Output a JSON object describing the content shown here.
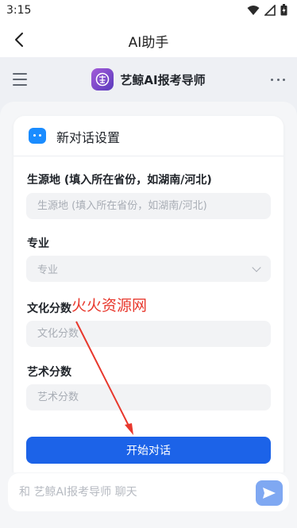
{
  "status_bar": {
    "time": "3:15"
  },
  "app_bar": {
    "title": "AI助手"
  },
  "chat_header": {
    "bot_name": "艺鲸AI报考导师"
  },
  "card": {
    "title": "新对话设置",
    "fields": [
      {
        "label": "生源地 (填入所在省份，如湖南/河北)",
        "placeholder": "生源地 (填入所在省份，如湖南/河北)"
      },
      {
        "label": "专业",
        "placeholder": "专业"
      },
      {
        "label": "文化分数",
        "placeholder": "文化分数"
      },
      {
        "label": "艺术分数",
        "placeholder": "艺术分数"
      }
    ],
    "start_button": "开始对话"
  },
  "chat_input": {
    "placeholder": "和 艺鲸AI报考导师 聊天"
  },
  "watermark": "火火资源网",
  "colors": {
    "primary": "#1c63e8",
    "send_button": "#7fa8f2",
    "watermark": "#e8382d"
  }
}
